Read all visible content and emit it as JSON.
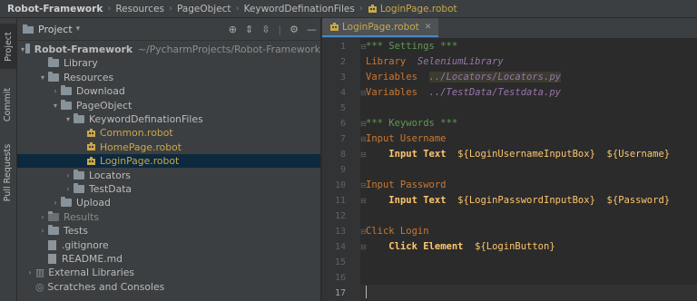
{
  "breadcrumb": [
    "Robot-Framework",
    "Resources",
    "PageObject",
    "KeywordDefinationFiles",
    "LoginPage.robot"
  ],
  "left_tabs": {
    "project": "Project",
    "commit": "Commit",
    "pull_requests": "Pull Requests"
  },
  "project_panel": {
    "title": "Project"
  },
  "tree": [
    {
      "label": "Robot-Framework",
      "hint": "~/PycharmProjects/Robot-Framework",
      "kind": "folder",
      "indent": 0,
      "arrow": "▾"
    },
    {
      "label": "Library",
      "kind": "folder",
      "indent": 1,
      "arrow": ""
    },
    {
      "label": "Resources",
      "kind": "folder",
      "indent": 1,
      "arrow": "▾"
    },
    {
      "label": "Download",
      "kind": "folder",
      "indent": 2,
      "arrow": "›"
    },
    {
      "label": "PageObject",
      "kind": "folder",
      "indent": 2,
      "arrow": "▾"
    },
    {
      "label": "KeywordDefinationFiles",
      "kind": "folder",
      "indent": 3,
      "arrow": "▾"
    },
    {
      "label": "Common.robot",
      "kind": "robot",
      "indent": 4,
      "arrow": ""
    },
    {
      "label": "HomePage.robot",
      "kind": "robot",
      "indent": 4,
      "arrow": ""
    },
    {
      "label": "LoginPage.robot",
      "kind": "robot",
      "indent": 4,
      "arrow": "",
      "selected": true
    },
    {
      "label": "Locators",
      "kind": "folder",
      "indent": 3,
      "arrow": "›"
    },
    {
      "label": "TestData",
      "kind": "folder",
      "indent": 3,
      "arrow": "›"
    },
    {
      "label": "Upload",
      "kind": "folder",
      "indent": 2,
      "arrow": "›"
    },
    {
      "label": "Results",
      "kind": "folder-dim",
      "indent": 1,
      "arrow": "›"
    },
    {
      "label": "Tests",
      "kind": "folder",
      "indent": 1,
      "arrow": "›"
    },
    {
      "label": ".gitignore",
      "kind": "file",
      "indent": 1,
      "arrow": ""
    },
    {
      "label": "README.md",
      "kind": "file",
      "indent": 1,
      "arrow": ""
    },
    {
      "label": "External Libraries",
      "kind": "lib",
      "indent": 0,
      "arrow": "›"
    },
    {
      "label": "Scratches and Consoles",
      "kind": "scratch",
      "indent": 0,
      "arrow": ""
    }
  ],
  "editor": {
    "tab_label": "LoginPage.robot",
    "line_numbers": [
      "1",
      "2",
      "3",
      "4",
      "5",
      "6",
      "7",
      "8",
      "9",
      "10",
      "11",
      "12",
      "13",
      "14",
      "15",
      "16",
      "17"
    ],
    "current_line": "17"
  },
  "code": {
    "l1": "*** Settings ***",
    "l2_kw": "Library",
    "l2_val": "SeleniumLibrary",
    "l3_kw": "Variables",
    "l3_val": "../Locators/Locators.py",
    "l4_kw": "Variables",
    "l4_val": "../TestData/Testdata.py",
    "l6": "*** Keywords ***",
    "l7": "Input Username",
    "l8_step": "Input Text",
    "l8_arg1": "${LoginUsernameInputBox}",
    "l8_arg2": "${Username}",
    "l10": "Input Password",
    "l11_step": "Input Text",
    "l11_arg1": "${LoginPasswordInputBox}",
    "l11_arg2": "${Password}",
    "l13": "Click Login",
    "l14_step": "Click Element",
    "l14_arg1": "${LoginButton}"
  },
  "colors": {
    "robot_file": "#c9a84a",
    "selection": "#0d293e",
    "accent": "#4a88c7"
  }
}
